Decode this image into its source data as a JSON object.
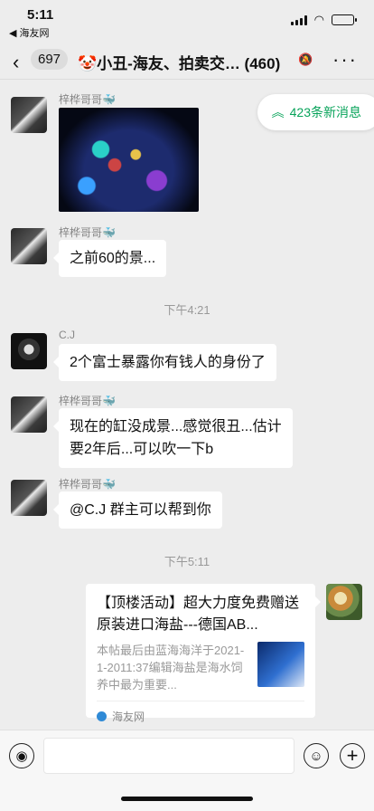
{
  "status": {
    "time": "5:11",
    "back_app": "◀ 海友网"
  },
  "nav": {
    "unread": "697",
    "title": "🤡小丑-海友、拍卖交… (460)"
  },
  "new_messages": {
    "label": "423条新消息"
  },
  "messages": [
    {
      "sender": "梓桦哥哥🐳",
      "type": "image"
    },
    {
      "sender": "梓桦哥哥🐳",
      "text": "之前60的景..."
    },
    {
      "sender": "C.J",
      "text": "2个富士暴露你有钱人的身份了"
    },
    {
      "sender": "梓桦哥哥🐳",
      "text_line1": "现在的缸没成景...感觉很丑...估计",
      "text_line2": "要2年后...可以吹一下b"
    },
    {
      "sender": "梓桦哥哥🐳",
      "text": "@C.J 群主可以帮到你"
    }
  ],
  "timestamps": [
    "下午4:21",
    "下午5:11"
  ],
  "link_card": {
    "title": "【顶楼活动】超大力度免费赠送原装进口海盐---德国AB...",
    "desc": "本帖最后由蓝海海洋于2021-1-2011:37编辑海盐是海水饲养中最为重要...",
    "source": "海友网"
  },
  "colors": {
    "accent": "#07a35a",
    "background": "#ededed"
  }
}
